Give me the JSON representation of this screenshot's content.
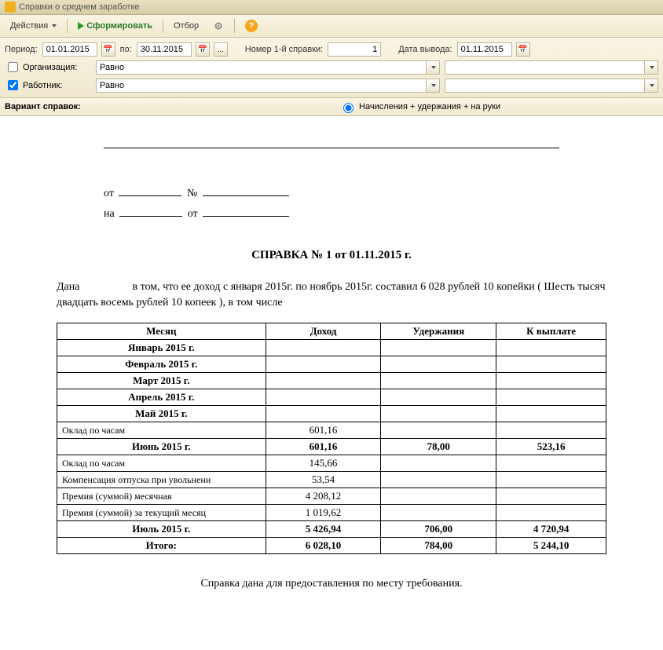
{
  "window": {
    "title": "Справки о среднем заработке"
  },
  "toolbar": {
    "actions_label": "Действия",
    "generate_label": "Сформировать",
    "filter_label": "Отбор"
  },
  "filters": {
    "period_label": "Период:",
    "date_from": "01.01.2015",
    "to_label": "по:",
    "date_to": "30.11.2015",
    "ellipsis": "...",
    "ref_no_label": "Номер 1-й справки:",
    "ref_no_value": "1",
    "output_date_label": "Дата вывода:",
    "output_date": "01.11.2015",
    "org_label": "Организация:",
    "org_mode": "Равно",
    "emp_label": "Работник:",
    "emp_mode": "Равно",
    "variant_label": "Вариант справок:",
    "variant_radio": "Начисления + удержания + на руки"
  },
  "doc": {
    "ot_label": "от",
    "no_label": "№",
    "na_label": "на",
    "title": "СПРАВКА  № 1 от 01.11.2015 г.",
    "text_prefix": "Дана ",
    "text_body": "в том, что  ее доход с января 2015г. по ноябрь 2015г. составил 6 028 рублей 10 копейки ( Шесть тысяч двадцать восемь рублей 10 копеек ), в том числе",
    "footer": "Справка дана для предоставления по месту требования.",
    "headers": [
      "Месяц",
      "Доход",
      "Удержания",
      "К выплате"
    ],
    "rows": [
      {
        "type": "month",
        "label": "Январь 2015 г.",
        "income": "",
        "withhold": "",
        "pay": ""
      },
      {
        "type": "month",
        "label": "Февраль 2015 г.",
        "income": "",
        "withhold": "",
        "pay": ""
      },
      {
        "type": "month",
        "label": "Март 2015 г.",
        "income": "",
        "withhold": "",
        "pay": ""
      },
      {
        "type": "month",
        "label": "Апрель 2015 г.",
        "income": "",
        "withhold": "",
        "pay": ""
      },
      {
        "type": "month",
        "label": "Май 2015 г.",
        "income": "",
        "withhold": "",
        "pay": ""
      },
      {
        "type": "detail",
        "label": "Оклад по часам",
        "income": "601,16",
        "withhold": "",
        "pay": ""
      },
      {
        "type": "month",
        "label": "Июнь 2015 г.",
        "income": "601,16",
        "withhold": "78,00",
        "pay": "523,16"
      },
      {
        "type": "detail",
        "label": "Оклад по часам",
        "income": "145,66",
        "withhold": "",
        "pay": ""
      },
      {
        "type": "detail",
        "label": "Компенсация отпуска при увольнени",
        "income": "53,54",
        "withhold": "",
        "pay": ""
      },
      {
        "type": "detail",
        "label": "Премия (суммой) месячная",
        "income": "4 208,12",
        "withhold": "",
        "pay": ""
      },
      {
        "type": "detail",
        "label": "Премия (суммой) за текущий месяц",
        "income": "1 019,62",
        "withhold": "",
        "pay": ""
      },
      {
        "type": "month",
        "label": "Июль 2015 г.",
        "income": "5 426,94",
        "withhold": "706,00",
        "pay": "4 720,94"
      },
      {
        "type": "total",
        "label": "Итого:",
        "income": "6 028,10",
        "withhold": "784,00",
        "pay": "5 244,10"
      }
    ]
  }
}
